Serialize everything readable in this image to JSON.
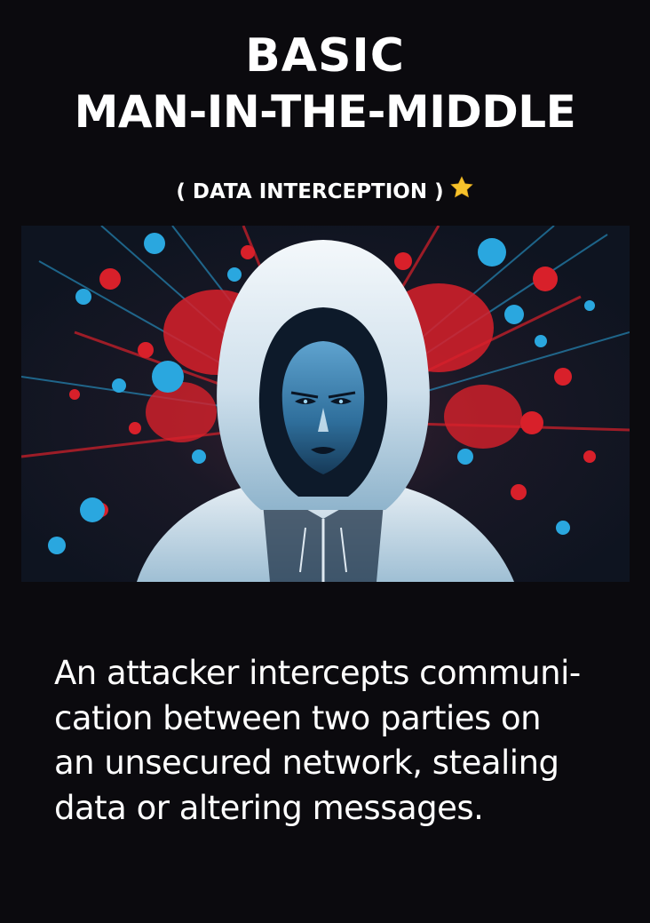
{
  "title": {
    "line1": "BASIC",
    "line2": "MAN-IN-THE-MIDDLE"
  },
  "subtitle": {
    "text": "( DATA INTERCEPTION )",
    "icon": "star-icon",
    "icon_color": "#f6c22b"
  },
  "illustration": {
    "subject": "hooded-hacker-illustration",
    "accent_colors": [
      "#d8202a",
      "#2aa7df",
      "#e8f0f6",
      "#0e1420"
    ]
  },
  "description": {
    "lines": [
      "An attacker intercepts communi-",
      "cation between two parties on",
      "an unsecured network, stealing",
      "data or altering messages."
    ]
  },
  "colors": {
    "background": "#0b0a0e",
    "text": "#ffffff"
  }
}
